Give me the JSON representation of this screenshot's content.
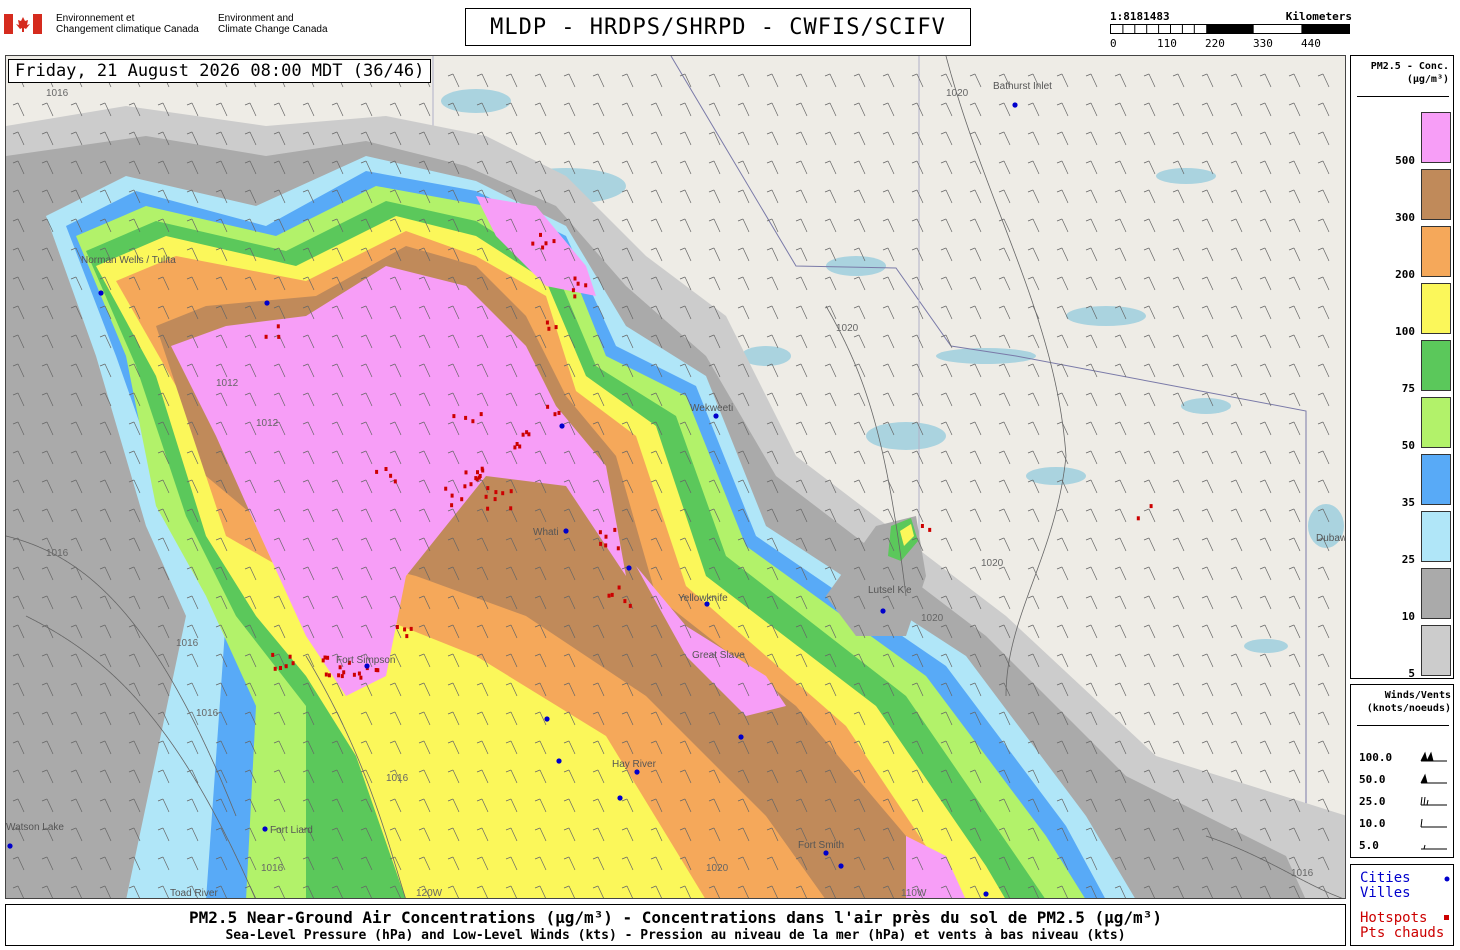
{
  "agency": {
    "fr_line1": "Environnement et",
    "fr_line2": "Changement climatique Canada",
    "en_line1": "Environment and",
    "en_line2": "Climate Change Canada"
  },
  "title": "MLDP - HRDPS/SHRPD - CWFIS/SCIFV",
  "scale": {
    "ratio": "1:8181483",
    "unit": "Kilometers",
    "ticks": [
      "0",
      "110",
      "220",
      "330",
      "440"
    ]
  },
  "timestamp": "Friday, 21 August 2026 08:00 MDT (36/46)",
  "legend": {
    "title_line1": "PM2.5 - Conc.",
    "title_line2": "(µg/m³)",
    "bins": [
      {
        "label": "500",
        "color": "#f79ef7"
      },
      {
        "label": "300",
        "color": "#c08a5a"
      },
      {
        "label": "200",
        "color": "#f5a85a"
      },
      {
        "label": "100",
        "color": "#fbf75a"
      },
      {
        "label": "75",
        "color": "#5bc85b"
      },
      {
        "label": "50",
        "color": "#b2f26a"
      },
      {
        "label": "35",
        "color": "#58aaf7"
      },
      {
        "label": "25",
        "color": "#b0e6f8"
      },
      {
        "label": "10",
        "color": "#aaaaaa"
      },
      {
        "label": "5",
        "color": "#cccccc"
      }
    ]
  },
  "winds": {
    "title_line1": "Winds/Vents",
    "title_line2": "(knots/noeuds)",
    "rows": [
      "100.0",
      "50.0",
      "25.0",
      "10.0",
      "5.0"
    ]
  },
  "markers": {
    "cities_en": "Cities",
    "cities_fr": "Villes",
    "hotspots_en": "Hotspots",
    "hotspots_fr": "Pts chauds",
    "city_color": "#0000cc",
    "hotspot_color": "#cc0000"
  },
  "footer": {
    "line1": "PM2.5 Near-Ground Air Concentrations (µg/m³) - Concentrations dans l'air près du sol de PM2.5 (µg/m³)",
    "line2": "Sea-Level Pressure (hPa) and Low-Level Winds (kts) - Pression au niveau de la mer (hPa) et vents à bas niveau (kts)"
  },
  "map": {
    "cities": [
      "Norman Wells / Tulita",
      "Bathurst Inlet",
      "Wekweeti",
      "Whati",
      "Yellowknife",
      "Lutsel K'e",
      "Great Slave",
      "Fort Simpson",
      "Hay River",
      "Fort Smith",
      "Fort Liard",
      "Toad River",
      "Watson Lake",
      "Dubawnt Lake"
    ],
    "isobars": [
      "1016",
      "1012",
      "1012",
      "1016",
      "1016",
      "1016",
      "1020",
      "1020",
      "1020",
      "1020",
      "1016",
      "1016",
      "1020",
      "1016"
    ],
    "meridians": [
      "120W",
      "110W"
    ]
  }
}
